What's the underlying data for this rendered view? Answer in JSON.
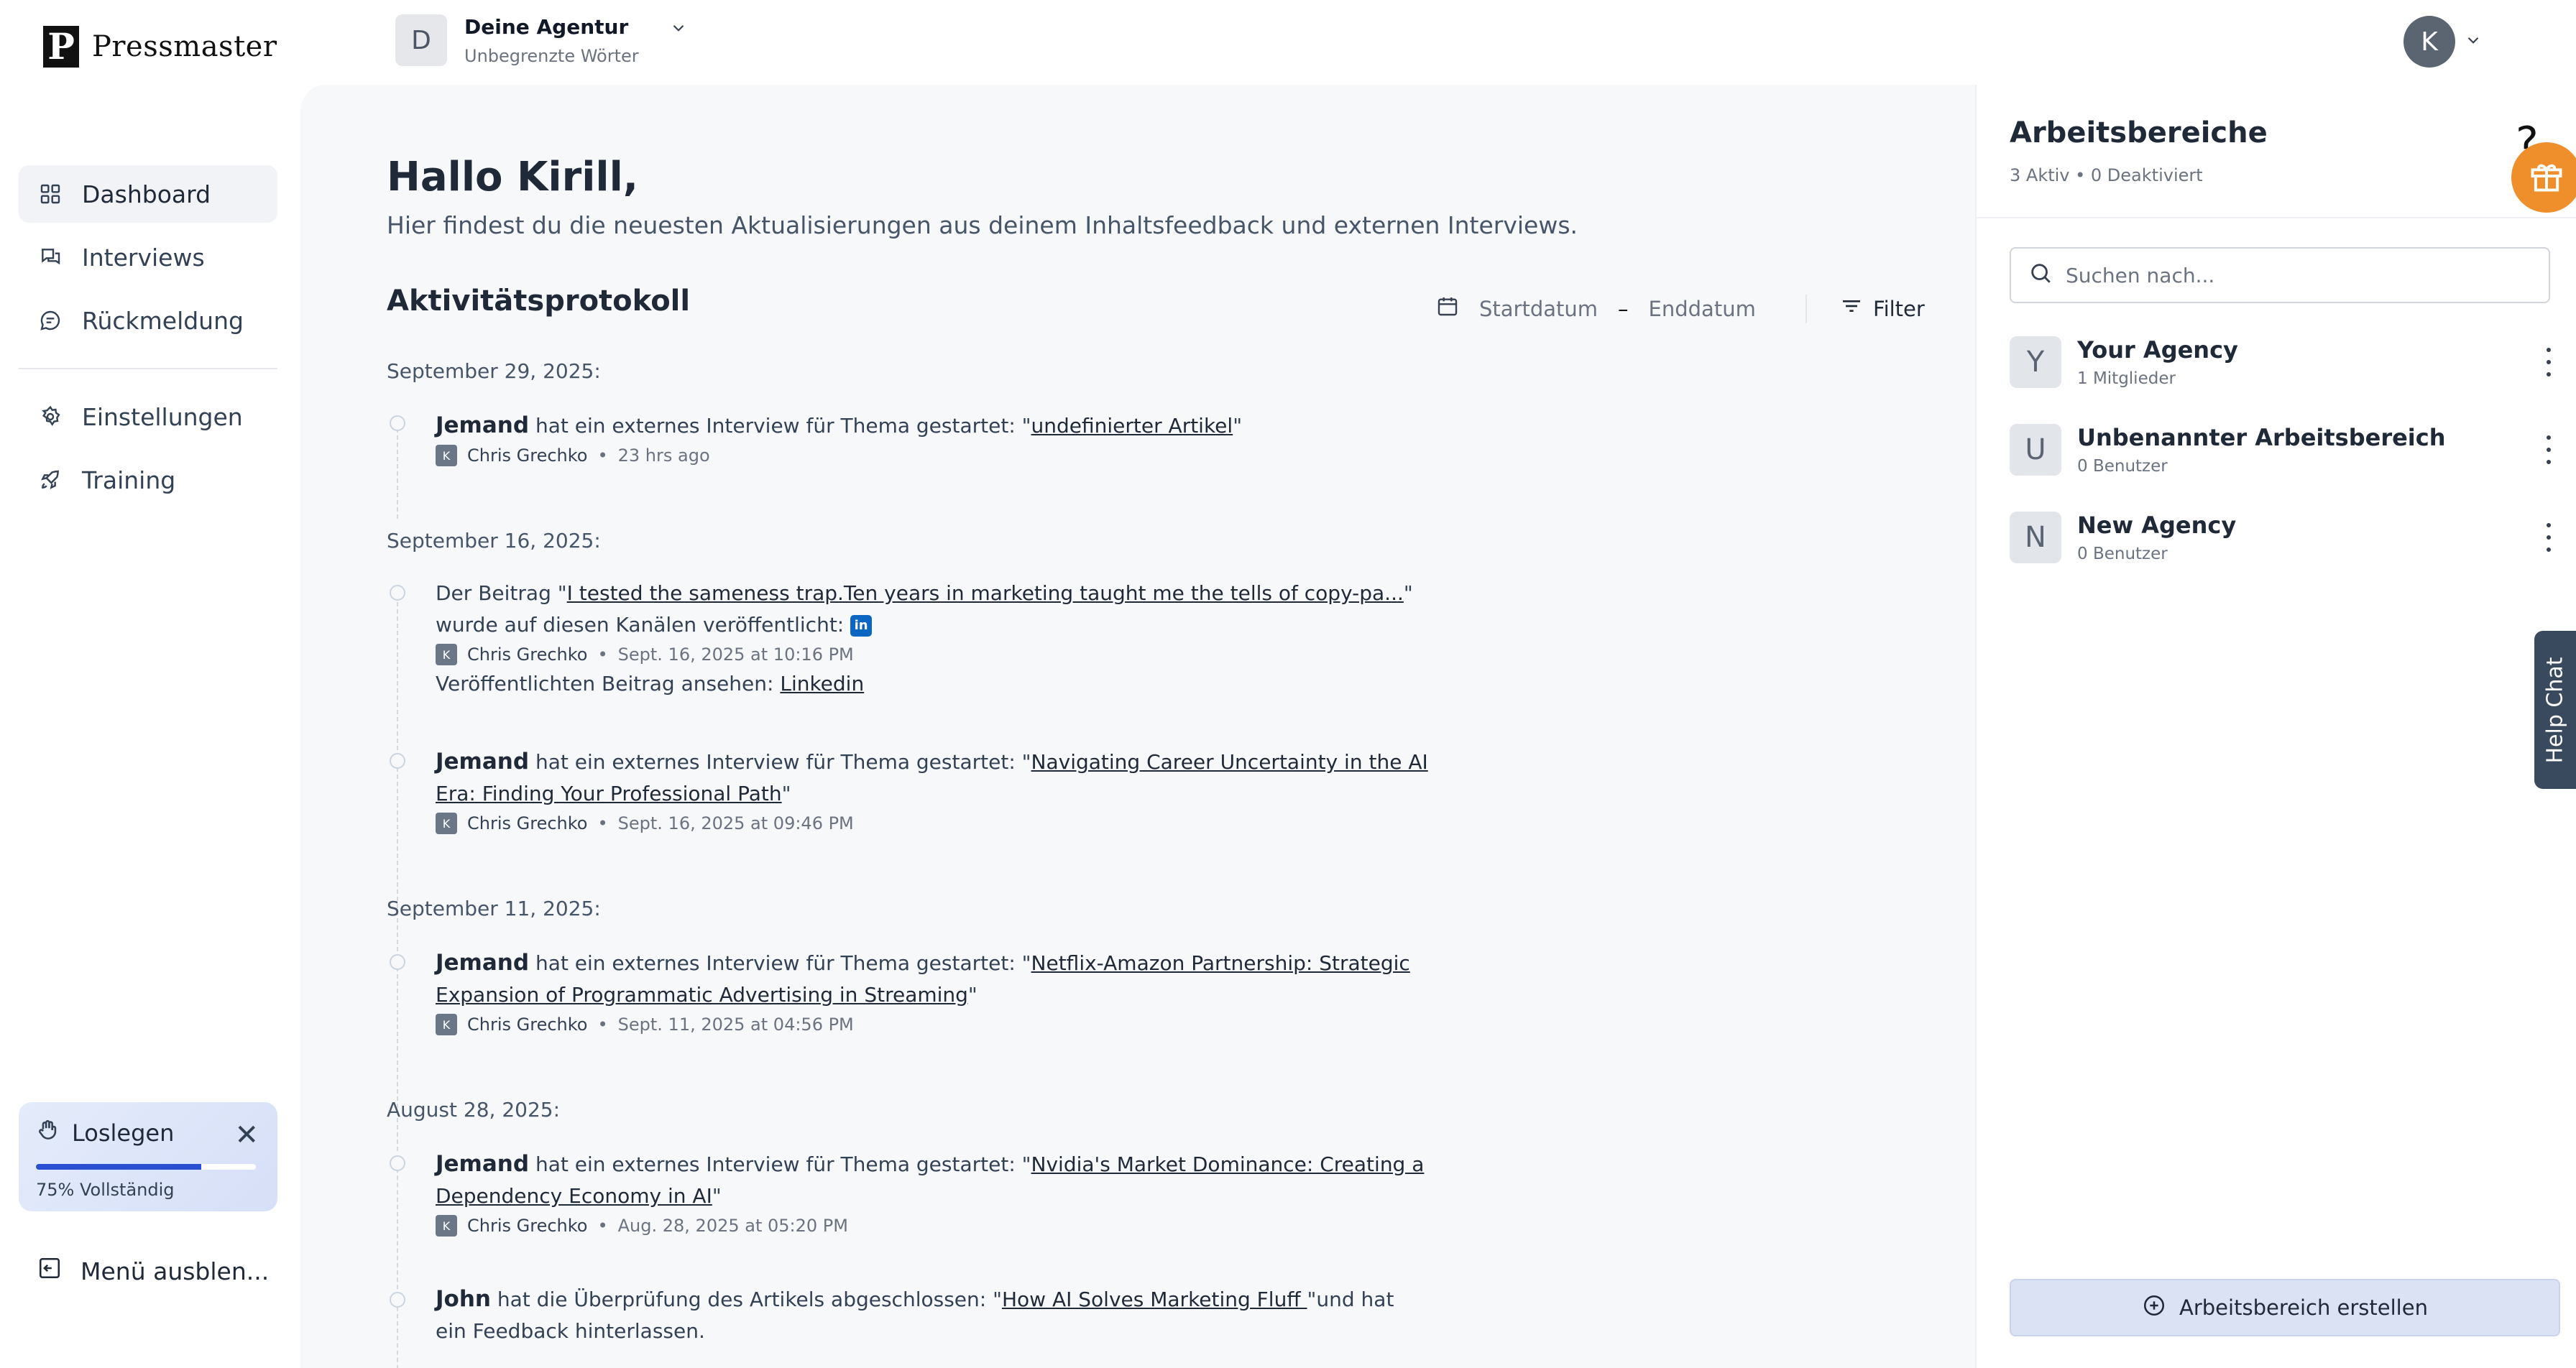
{
  "brand": {
    "name": "Pressmaster",
    "mark": "P"
  },
  "sidebar": {
    "items": [
      {
        "label": "Dashboard",
        "icon": "grid-icon",
        "active": true
      },
      {
        "label": "Interviews",
        "icon": "chat-bubbles-icon"
      },
      {
        "label": "Rückmeldung",
        "icon": "message-circle-icon"
      },
      {
        "label": "Einstellungen",
        "icon": "gear-icon"
      },
      {
        "label": "Training",
        "icon": "rocket-icon"
      }
    ],
    "onboarding": {
      "title": "Loslegen",
      "progress_pct": 75,
      "progress_label": "75% Vollständig"
    },
    "collapse_label": "Menü ausblen..."
  },
  "header": {
    "agency": {
      "initial": "D",
      "name": "Deine Agentur",
      "plan": "Unbegrenzte Wörter"
    },
    "user": {
      "initial": "K"
    }
  },
  "main": {
    "greeting": "Hallo Kirill,",
    "subtitle": "Hier findest du die neuesten Aktualisierungen aus deinem Inhaltsfeedback und externen Interviews.",
    "log_title": "Aktivitätsprotokoll",
    "start_date_placeholder": "Startdatum",
    "date_dash": "–",
    "end_date_placeholder": "Enddatum",
    "filter_label": "Filter",
    "groups": [
      {
        "date": "September 29, 2025:"
      },
      {
        "date": "September 16, 2025:"
      },
      {
        "date": "September 11, 2025:"
      },
      {
        "date": "August 28, 2025:"
      }
    ],
    "activities": [
      {
        "actor": "Jemand",
        "text": " hat ein externes Interview für Thema gestartet: \"",
        "link": "undefinierter Artikel",
        "tail": "\"",
        "author_initial": "K",
        "author": "Chris Grechko",
        "sep": "•",
        "time": "23 hrs ago"
      },
      {
        "prefix": "Der Beitrag \"",
        "link": "I tested the sameness trap.Ten years in marketing taught me the tells of copy-pa...",
        "tail": "\" wurde auf diesen Kanälen veröffentlicht:",
        "badge": "in",
        "author_initial": "K",
        "author": "Chris Grechko",
        "sep": "•",
        "time": "Sept. 16, 2025 at 10:16 PM",
        "view_label": "Veröffentlichten Beitrag ansehen:",
        "view_link": "Linkedin"
      },
      {
        "actor": "Jemand",
        "text": " hat ein externes Interview für Thema gestartet: \"",
        "link": "Navigating Career Uncertainty in the AI Era: Finding Your Professional Path",
        "tail": "\"",
        "author_initial": "K",
        "author": "Chris Grechko",
        "sep": "•",
        "time": "Sept. 16, 2025 at 09:46 PM"
      },
      {
        "actor": "Jemand",
        "text": " hat ein externes Interview für Thema gestartet: \"",
        "link": "Netflix-Amazon Partnership: Strategic Expansion of Programmatic Advertising in Streaming",
        "tail": "\"",
        "author_initial": "K",
        "author": "Chris Grechko",
        "sep": "•",
        "time": "Sept. 11, 2025 at 04:56 PM"
      },
      {
        "actor": "Jemand",
        "text": " hat ein externes Interview für Thema gestartet: \"",
        "link": "Nvidia's Market Dominance: Creating a Dependency Economy in AI",
        "tail": "\"",
        "author_initial": "K",
        "author": "Chris Grechko",
        "sep": "•",
        "time": "Aug. 28, 2025 at 05:20 PM"
      },
      {
        "actor": "John",
        "text": " hat die Überprüfung des Artikels abgeschlossen: \"",
        "link": "How AI Solves Marketing Fluff ",
        "tail": "\"und hat ein Feedback hinterlassen."
      }
    ]
  },
  "workspaces": {
    "title": "Arbeitsbereiche",
    "summary": "3 Aktiv • 0 Deaktiviert",
    "search_placeholder": "Suchen nach...",
    "items": [
      {
        "initial": "Y",
        "name": "Your Agency",
        "count": "1 Mitglieder"
      },
      {
        "initial": "U",
        "name": "Unbenannter Arbeitsbereich",
        "count": "0 Benutzer"
      },
      {
        "initial": "N",
        "name": "New Agency",
        "count": "0 Benutzer"
      }
    ],
    "create_label": "Arbeitsbereich erstellen"
  },
  "widgets": {
    "help_chat": "Help Chat",
    "help_mark": "?"
  },
  "colors": {
    "accent": "#2b4fd1",
    "gift": "#ef8f2c",
    "linkedin": "#0a66c2",
    "help_chat_bg": "#3a4a5e"
  }
}
